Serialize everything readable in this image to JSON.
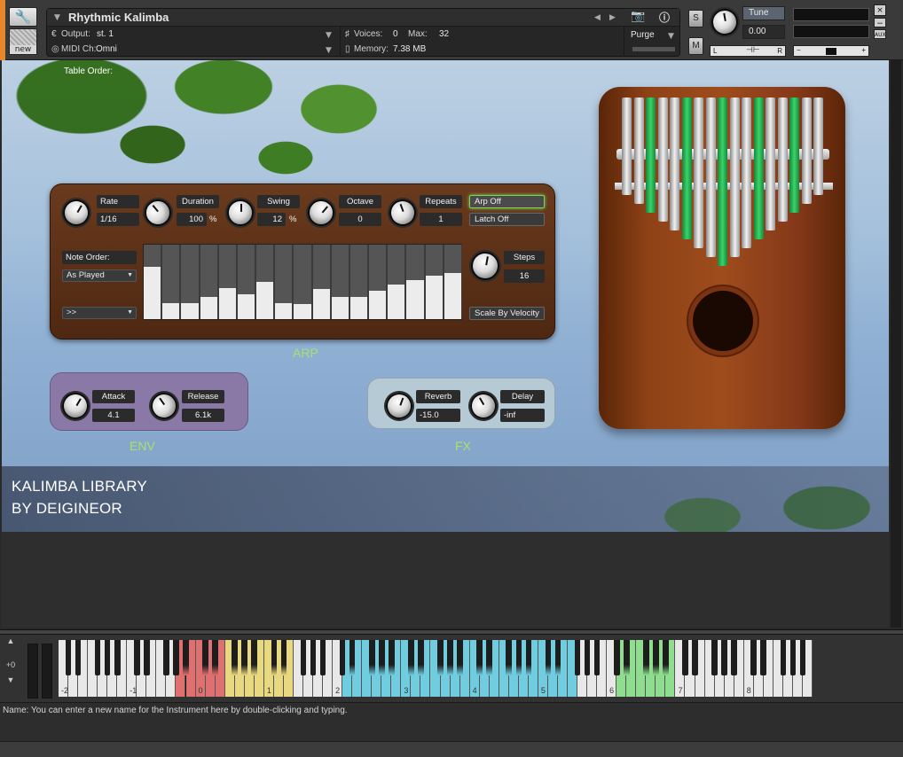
{
  "header": {
    "instrument_name": "Rhythmic Kalimba",
    "output_label": "Output:",
    "output_value": "st. 1",
    "midi_label": "MIDI Ch:",
    "midi_value": "Omni",
    "voices_label": "Voices:",
    "voices_value": "0",
    "max_label": "Max:",
    "max_value": "32",
    "memory_label": "Memory:",
    "memory_value": "7.38 MB",
    "purge_label": "Purge",
    "solo_label": "S",
    "mute_label": "M",
    "tune_label": "Tune",
    "tune_value": "0.00",
    "pan_left": "L",
    "pan_right": "R",
    "vol_minus": "−",
    "vol_plus": "+",
    "aux_label": "AUX",
    "close_label": "×",
    "minimize_label": "−",
    "new_label": "new"
  },
  "stage": {
    "table_order_label": "Table Order:",
    "library_line1": "KALIMBA LIBRARY",
    "library_line2": "BY DEIGINEOR"
  },
  "arp": {
    "title": "ARP",
    "knobs": [
      {
        "label": "Rate",
        "value": "1/16",
        "unit": ""
      },
      {
        "label": "Duration",
        "value": "100",
        "unit": "%"
      },
      {
        "label": "Swing",
        "value": "12",
        "unit": "%"
      },
      {
        "label": "Octave",
        "value": "0",
        "unit": ""
      },
      {
        "label": "Repeats",
        "value": "1",
        "unit": ""
      }
    ],
    "arp_off_label": "Arp Off",
    "latch_off_label": "Latch Off",
    "note_order_label": "Note Order:",
    "note_order_value": "As Played",
    "direction_value": ">>",
    "steps_label": "Steps",
    "steps_value": "16",
    "scale_by_velocity_label": "Scale By Velocity",
    "step_levels": [
      0.7,
      0.22,
      0.22,
      0.3,
      0.42,
      0.33,
      0.5,
      0.22,
      0.2,
      0.4,
      0.3,
      0.3,
      0.38,
      0.47,
      0.52,
      0.58,
      0.62
    ]
  },
  "env": {
    "title": "ENV",
    "knobs": [
      {
        "label": "Attack",
        "value": "4.1"
      },
      {
        "label": "Release",
        "value": "6.1k"
      }
    ]
  },
  "fx": {
    "title": "FX",
    "knobs": [
      {
        "label": "Reverb",
        "value": "-15.0"
      },
      {
        "label": "Delay",
        "value": "-inf"
      }
    ]
  },
  "keyboard": {
    "octave_shift": "+0",
    "octave_labels": [
      "-2",
      "-1",
      "0",
      "1",
      "2",
      "3",
      "4",
      "5",
      "6",
      "7",
      "8"
    ],
    "colors": {
      "red": "#e07070",
      "yellow": "#e8d880",
      "cyan": "#70cde0",
      "green": "#8fde8f"
    }
  },
  "status": {
    "text": "Name: You can enter a new name for the Instrument here by double-clicking and typing."
  }
}
